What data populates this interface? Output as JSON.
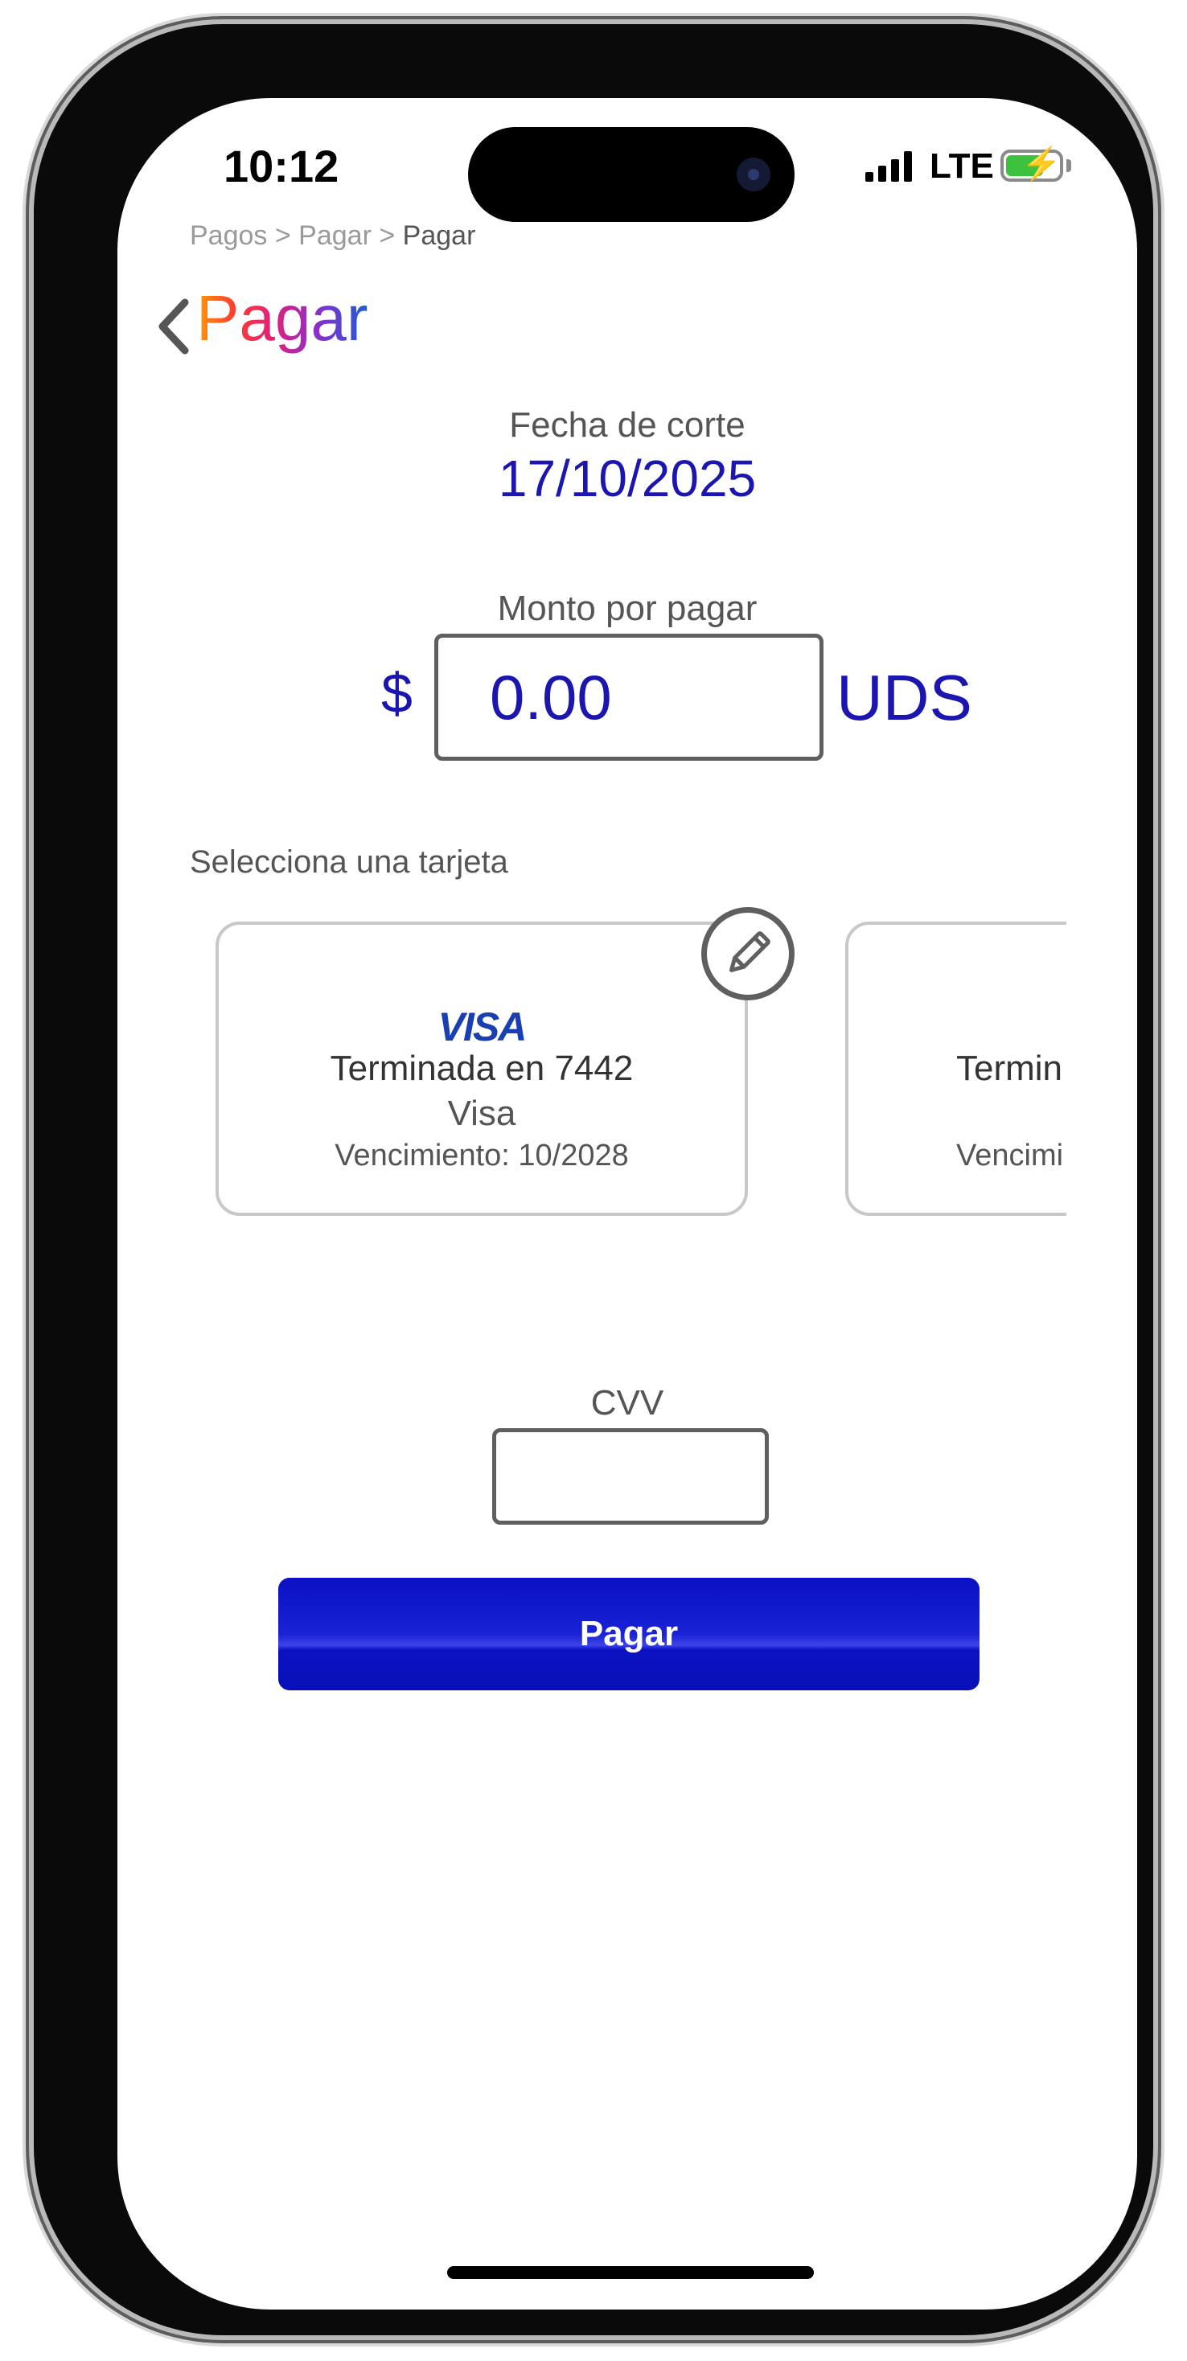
{
  "status_bar": {
    "time": "10:12",
    "network": "LTE",
    "battery_state": "charging",
    "battery_color": "#3cc23c"
  },
  "breadcrumb": {
    "items": [
      "Pagos",
      "Pagar"
    ],
    "separator": ">",
    "current": "Pagar"
  },
  "header": {
    "back_icon": "chevron-left-icon",
    "title": "Pagar",
    "title_gradient": [
      "#ff9a00",
      "#ff3d2e",
      "#e0217a",
      "#8b2fc9",
      "#1f5bd8"
    ]
  },
  "cut_date": {
    "label": "Fecha de corte",
    "value": "17/10/2025"
  },
  "amount": {
    "label": "Monto por pagar",
    "currency_symbol": "$",
    "value": "0.00",
    "unit": "UDS"
  },
  "cards_section": {
    "label": "Selecciona una tarjeta",
    "edit_icon": "pencil-icon",
    "cards": [
      {
        "brand_logo": "VISA",
        "ending": "Terminada en 7442",
        "type": "Visa",
        "expiry": "Vencimiento: 10/2028"
      },
      {
        "ending": "Termin",
        "expiry": "Vencimi"
      }
    ]
  },
  "cvv": {
    "label": "CVV",
    "value": ""
  },
  "pay_button": {
    "label": "Pagar"
  },
  "colors": {
    "accent_blue": "#1c16b0",
    "button_blue": "#0a10c4",
    "visa_blue": "#1a3fb0"
  }
}
